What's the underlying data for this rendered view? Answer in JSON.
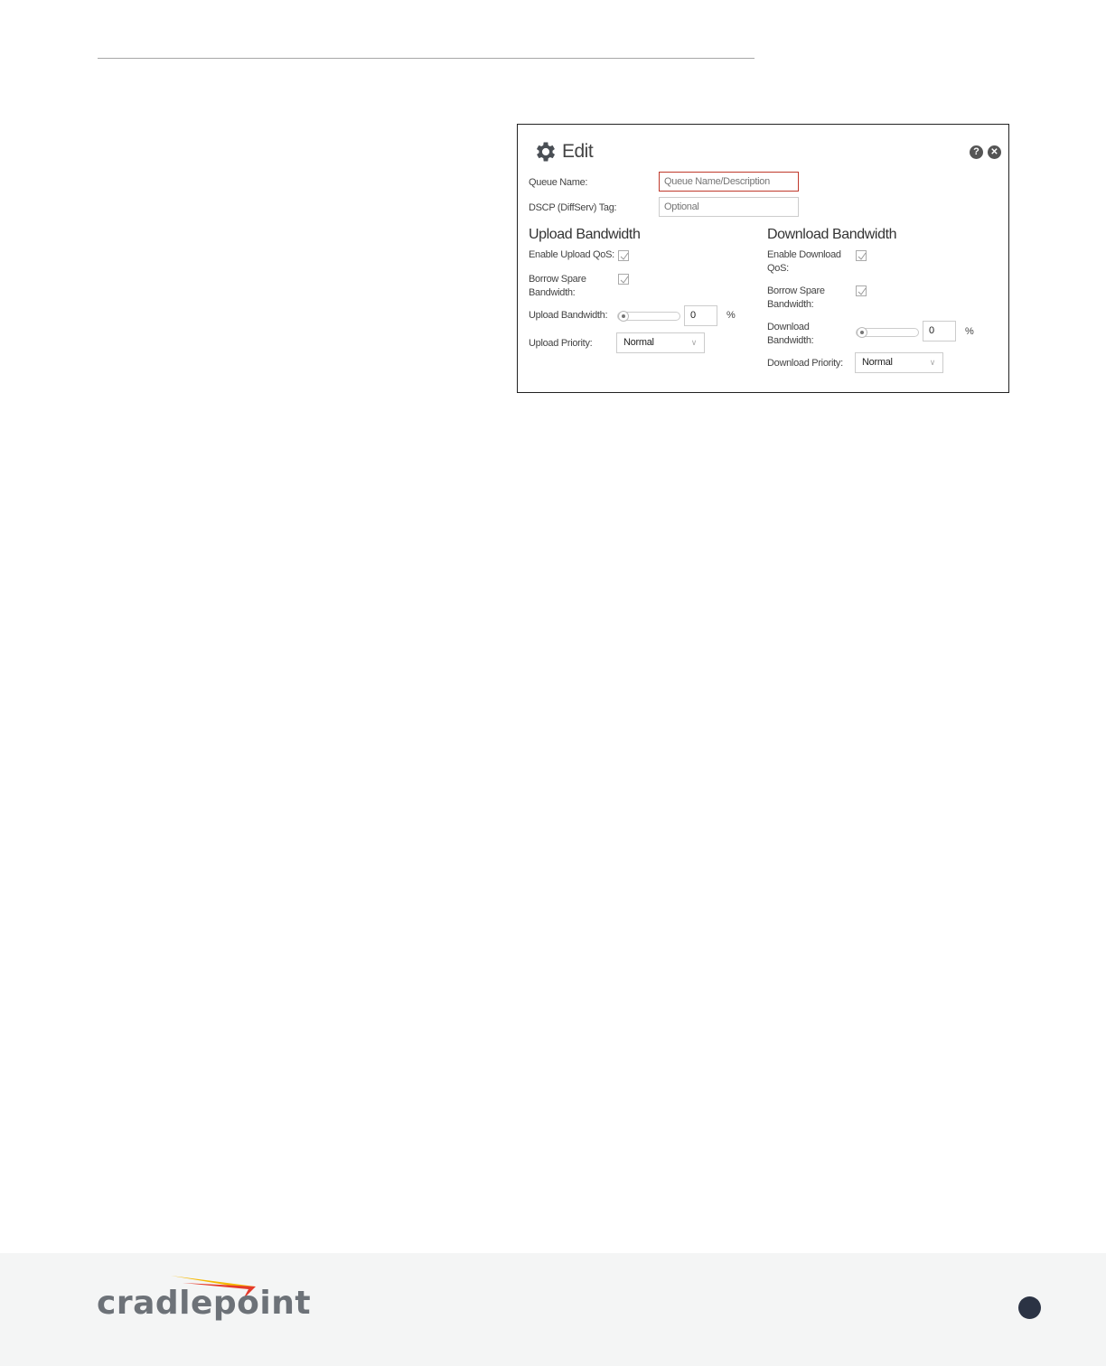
{
  "dialog": {
    "title": "Edit",
    "icons": {
      "title_icon": "gear-icon",
      "help": "help-icon",
      "close": "close-icon"
    },
    "help_glyph": "?",
    "close_glyph": "✕",
    "queue_name": {
      "label": "Queue Name:",
      "value": "",
      "placeholder": "Queue Name/Description"
    },
    "dscp_tag": {
      "label": "DSCP (DiffServ) Tag:",
      "value": "",
      "placeholder": "Optional"
    },
    "upload": {
      "title": "Upload Bandwidth",
      "enable_qos": {
        "label": "Enable Upload QoS:",
        "checked": true
      },
      "borrow_spare": {
        "label_line1": "Borrow Spare",
        "label_line2": "Bandwidth:",
        "checked": true
      },
      "bandwidth": {
        "label": "Upload Bandwidth:",
        "value": "0",
        "unit": "%",
        "slider_percent": 0
      },
      "priority": {
        "label": "Upload Priority:",
        "selected": "Normal"
      }
    },
    "download": {
      "title": "Download Bandwidth",
      "enable_qos": {
        "label_line1": "Enable Download",
        "label_line2": "QoS:",
        "checked": true
      },
      "borrow_spare": {
        "label_line1": "Borrow Spare",
        "label_line2": "Bandwidth:",
        "checked": true
      },
      "bandwidth": {
        "label_line1": "Download",
        "label_line2": "Bandwidth:",
        "value": "0",
        "unit": "%",
        "slider_percent": 0
      },
      "priority": {
        "label": "Download Priority:",
        "selected": "Normal"
      }
    }
  },
  "footer": {
    "logo_text": "cradlepoint",
    "logo_colors": {
      "text": "#6d7278",
      "swoosh_yellow": "#f5b800",
      "swoosh_red": "#e53a2b"
    },
    "page_indicator_color": "#2b3344"
  }
}
